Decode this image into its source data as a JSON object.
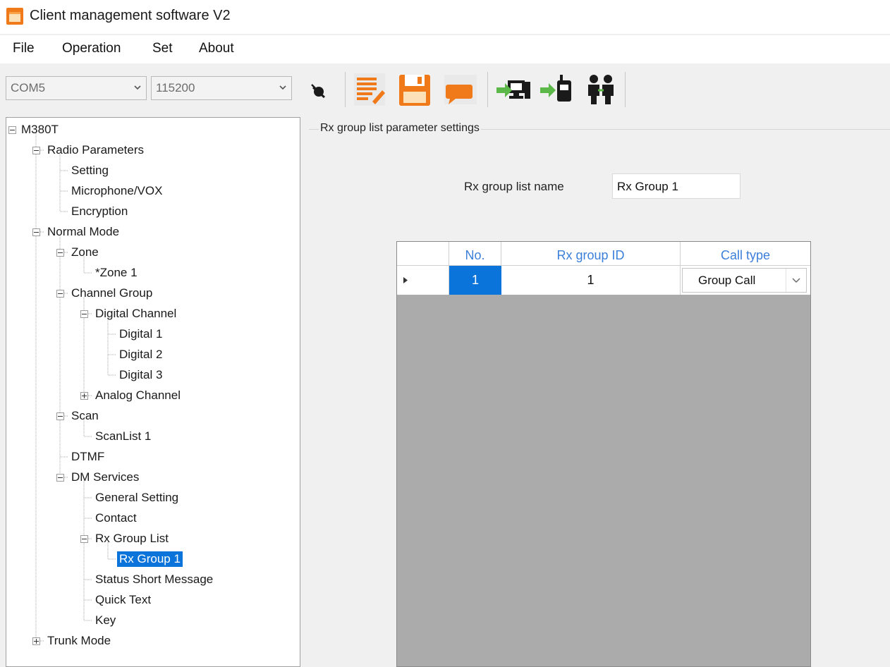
{
  "window": {
    "title": "Client management software V2"
  },
  "menu": [
    {
      "label": "File"
    },
    {
      "label": "Operation"
    },
    {
      "label": "Set"
    },
    {
      "label": "About"
    }
  ],
  "toolbar": {
    "port": "COM5",
    "baud": "115200",
    "icons": [
      "disconnected-icon",
      "edit-icon",
      "save-icon",
      "message-icon",
      "computer-read-icon",
      "radio-write-icon",
      "users-icon"
    ]
  },
  "tree": {
    "nodes": [
      {
        "label": "M380T",
        "level": 0,
        "expander": "minus"
      },
      {
        "label": "Radio Parameters",
        "level": 1,
        "expander": "minus"
      },
      {
        "label": "Setting",
        "level": 2
      },
      {
        "label": "Microphone/VOX",
        "level": 2
      },
      {
        "label": "Encryption",
        "level": 2
      },
      {
        "label": "Normal Mode",
        "level": 1,
        "expander": "minus"
      },
      {
        "label": "Zone",
        "level": 2,
        "expander": "minus"
      },
      {
        "label": "*Zone 1",
        "level": 3
      },
      {
        "label": "Channel Group",
        "level": 2,
        "expander": "minus"
      },
      {
        "label": "Digital Channel",
        "level": 3,
        "expander": "minus"
      },
      {
        "label": "Digital 1",
        "level": 4
      },
      {
        "label": "Digital 2",
        "level": 4
      },
      {
        "label": "Digital 3",
        "level": 4
      },
      {
        "label": "Analog Channel",
        "level": 3,
        "expander": "plus"
      },
      {
        "label": "Scan",
        "level": 2,
        "expander": "minus"
      },
      {
        "label": "ScanList 1",
        "level": 3
      },
      {
        "label": "DTMF",
        "level": 2
      },
      {
        "label": "DM Services",
        "level": 2,
        "expander": "minus"
      },
      {
        "label": "General Setting",
        "level": 3
      },
      {
        "label": "Contact",
        "level": 3
      },
      {
        "label": "Rx Group List",
        "level": 3,
        "expander": "minus"
      },
      {
        "label": "Rx Group 1",
        "level": 4,
        "selected": true
      },
      {
        "label": "Status Short Message",
        "level": 3
      },
      {
        "label": "Quick Text",
        "level": 3
      },
      {
        "label": "Key",
        "level": 3
      },
      {
        "label": "Trunk Mode",
        "level": 1,
        "expander": "plus"
      }
    ]
  },
  "panel": {
    "group_title": "Rx group list parameter settings",
    "name_label": "Rx group list name",
    "name_value": "Rx Group 1",
    "columns": [
      "No.",
      "Rx group ID",
      "Call type"
    ],
    "rows": [
      {
        "no": "1",
        "id": "1",
        "call_type": "Group Call"
      }
    ]
  },
  "colors": {
    "selection": "#0a74da",
    "header_text": "#3b7fd9",
    "grid_background": "#ababab"
  }
}
